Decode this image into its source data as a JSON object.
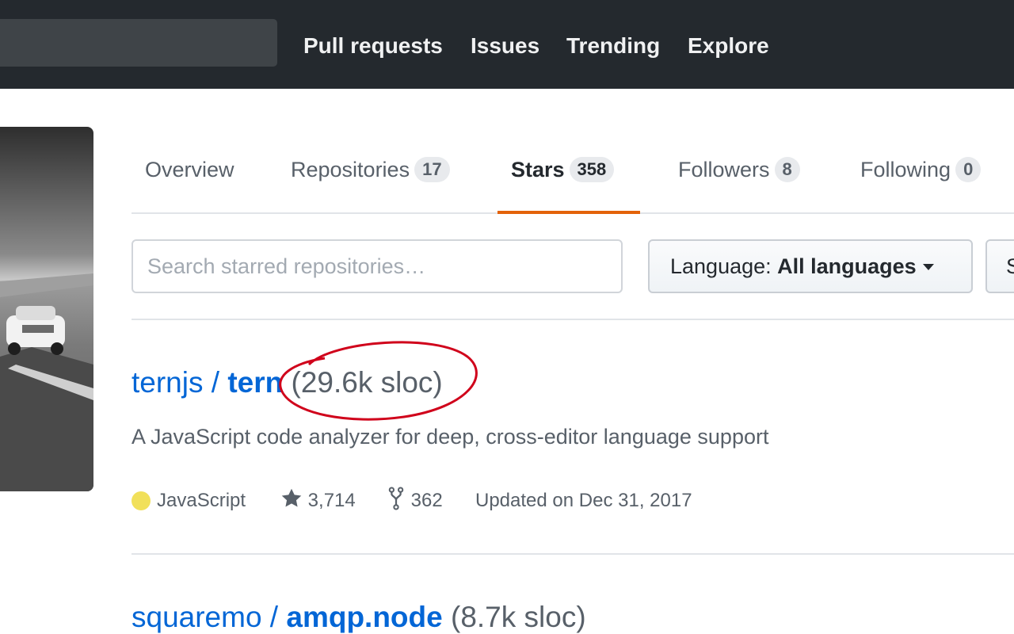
{
  "header": {
    "nav": [
      "Pull requests",
      "Issues",
      "Trending",
      "Explore"
    ]
  },
  "tabs": [
    {
      "label": "Overview",
      "count": null
    },
    {
      "label": "Repositories",
      "count": "17"
    },
    {
      "label": "Stars",
      "count": "358",
      "selected": true
    },
    {
      "label": "Followers",
      "count": "8"
    },
    {
      "label": "Following",
      "count": "0"
    }
  ],
  "filters": {
    "search_placeholder": "Search starred repositories…",
    "language_label": "Language:",
    "language_value": "All languages",
    "sort_label": "S"
  },
  "repos": [
    {
      "owner": "ternjs",
      "separator": " / ",
      "name": "tern",
      "sloc": "(29.6k sloc)",
      "description": "A JavaScript code analyzer for deep, cross-editor language support",
      "language": "JavaScript",
      "language_color": "#f1e05a",
      "stars": "3,714",
      "forks": "362",
      "updated": "Updated on Dec 31, 2017"
    },
    {
      "owner": "squaremo",
      "separator": " / ",
      "name": "amqp.node",
      "sloc": "(8.7k sloc)"
    }
  ],
  "colors": {
    "header_bg": "#24292e",
    "link": "#0366d6",
    "tab_underline": "#e36209",
    "annotation": "#d0021b"
  },
  "icons": [
    "star-icon",
    "fork-icon"
  ]
}
